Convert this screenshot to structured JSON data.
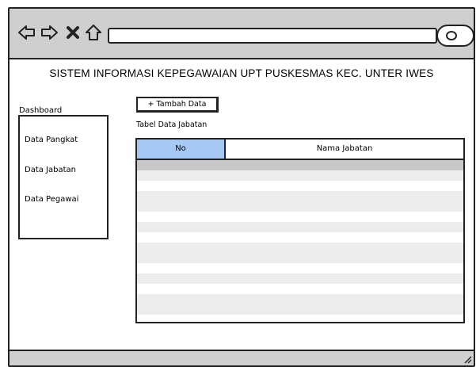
{
  "browser": {
    "address": "",
    "icons": [
      "back-arrow-icon",
      "forward-arrow-icon",
      "close-icon",
      "home-icon",
      "search-icon"
    ]
  },
  "page": {
    "title": "SISTEM INFORMASI KEPEGAWAIAN UPT PUSKESMAS KEC. UNTER IWES"
  },
  "sidebar": {
    "heading": "Dashboard",
    "items": [
      {
        "label": "Data Pangkat"
      },
      {
        "label": "Data Jabatan"
      },
      {
        "label": "Data Pegawai"
      }
    ]
  },
  "main": {
    "add_button_label": "+ Tambah Data",
    "table_caption": "Tabel Data Jabatan",
    "table": {
      "columns": [
        "No",
        "Nama Jabatan"
      ],
      "rows": []
    }
  },
  "colors": {
    "toolbar_bg": "#cfcfcf",
    "header_highlight": "#a7c8f5",
    "row_alt": "#ececec"
  }
}
